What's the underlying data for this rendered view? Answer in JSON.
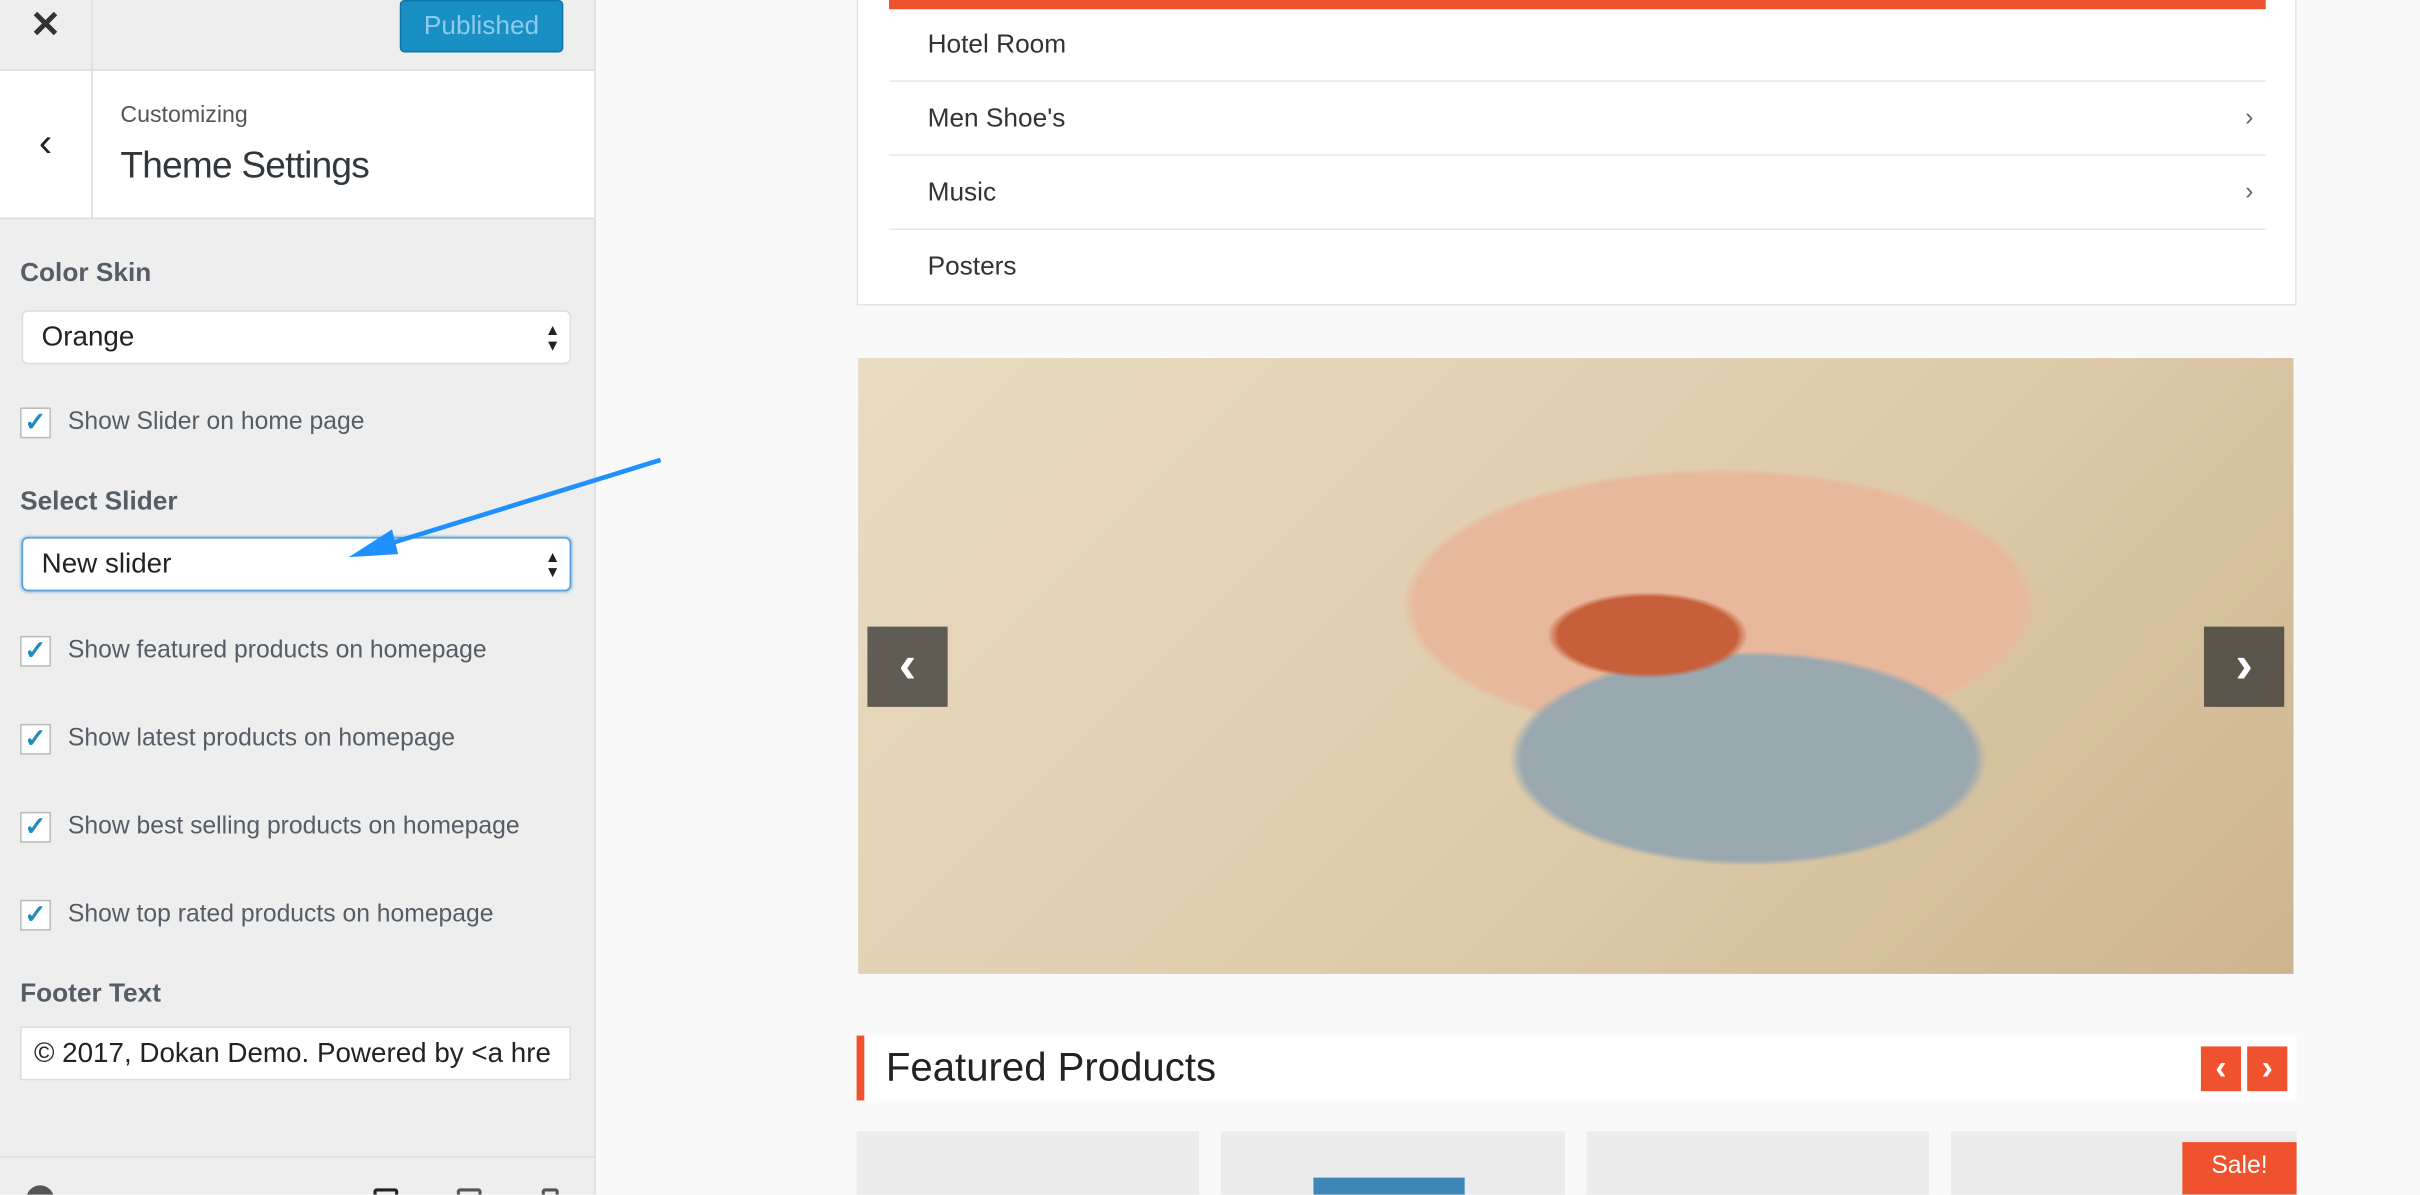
{
  "sidebar": {
    "close_icon": "close-icon",
    "publish_label": "Published",
    "breadcrumb": "Customizing",
    "title": "Theme Settings",
    "color_skin": {
      "label": "Color Skin",
      "value": "Orange"
    },
    "show_slider": {
      "label": "Show Slider on home page",
      "checked": true
    },
    "select_slider": {
      "label": "Select Slider",
      "value": "New slider"
    },
    "checkboxes": [
      {
        "label": "Show featured products on homepage",
        "checked": true
      },
      {
        "label": "Show latest products on homepage",
        "checked": true
      },
      {
        "label": "Show best selling products on homepage",
        "checked": true
      },
      {
        "label": "Show top rated products on homepage",
        "checked": true
      }
    ],
    "footer_text": {
      "label": "Footer Text",
      "value": "© 2017, Dokan Demo. Powered by <a hre"
    }
  },
  "preview": {
    "menu": [
      {
        "label": "Hotel Room",
        "has_children": false
      },
      {
        "label": "Men Shoe's",
        "has_children": true
      },
      {
        "label": "Music",
        "has_children": true
      },
      {
        "label": "Posters",
        "has_children": false
      }
    ],
    "slider": {
      "prev": "‹",
      "next": "›"
    },
    "featured": {
      "title": "Featured Products",
      "prev": "‹",
      "next": "›"
    },
    "sale_badge": "Sale!"
  },
  "colors": {
    "accent": "#f0522f",
    "wp_blue": "#1a8fc4",
    "annotation_arrow": "#1e90ff"
  }
}
